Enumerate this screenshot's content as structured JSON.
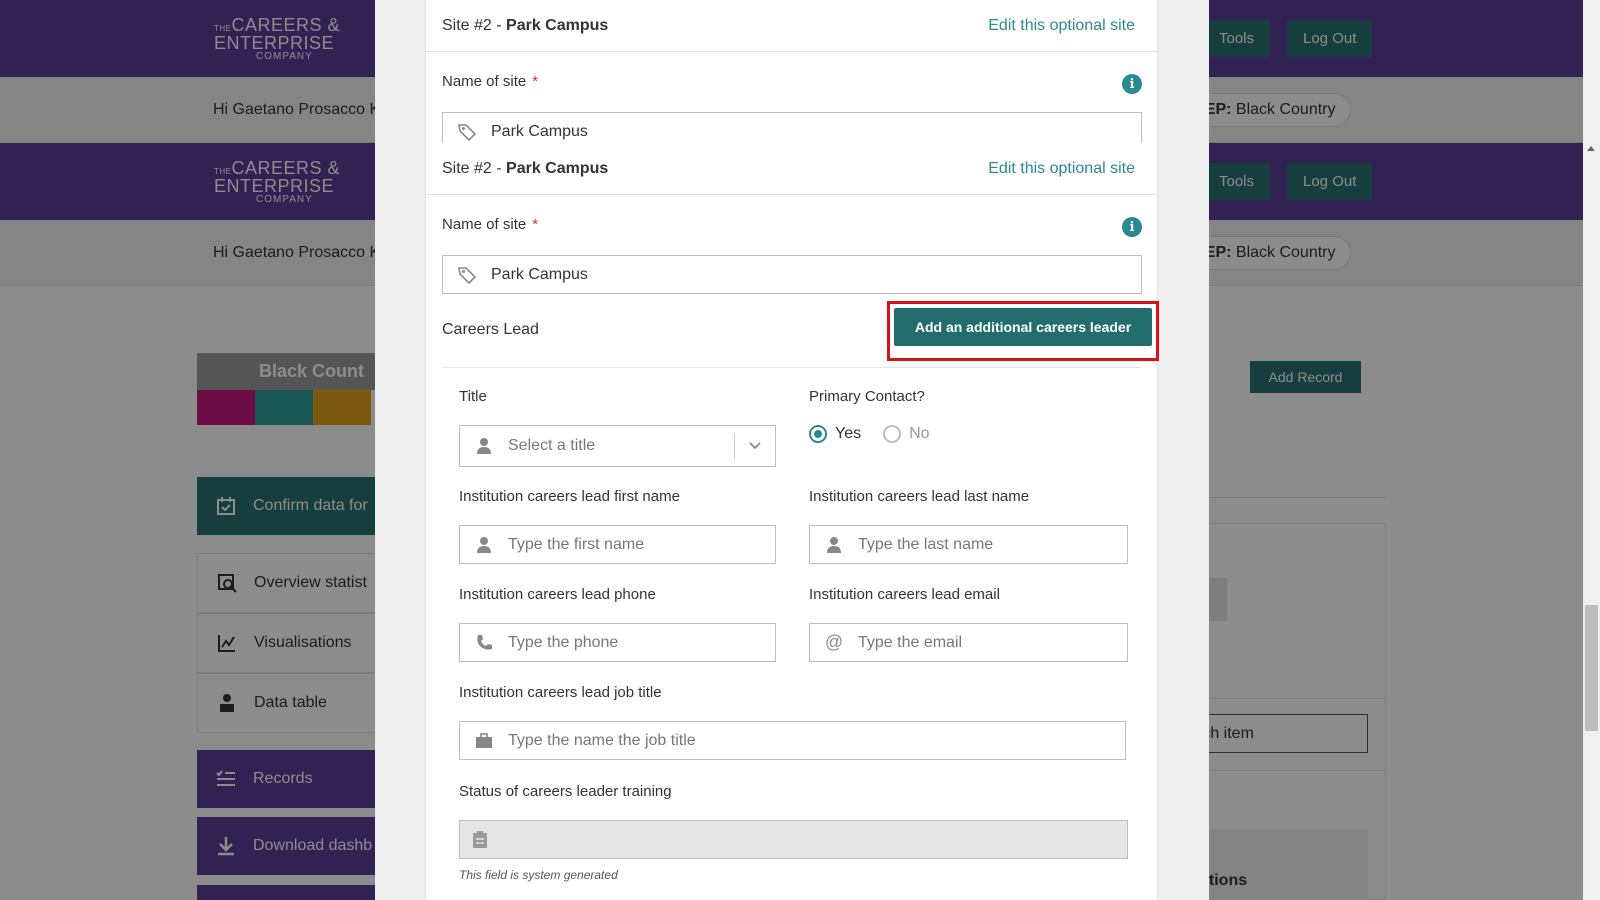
{
  "background": {
    "logo": {
      "line1": "CAREERS &",
      "line2": "ENTERPRISE",
      "line3": "COMPANY",
      "prefix": "THE"
    },
    "header_buttons": {
      "tools": "Tools",
      "logout": "Log Out"
    },
    "greeting": "Hi Gaetano Prosacco K",
    "lep": {
      "label": "LEP:",
      "value": "Black Country"
    },
    "sidebar": {
      "region_title": "Black Count",
      "swatch_colors": [
        "#c4187c",
        "#2f9e9a",
        "#e0a21b"
      ],
      "confirm": "Confirm data for",
      "items": [
        "Overview statist",
        "Visualisations",
        "Data table"
      ],
      "records": "Records",
      "download": "Download dashb"
    },
    "add_record": "Add Record",
    "search_placeholder": "rch item",
    "sections_label": "ctions"
  },
  "modal": {
    "site_prefix": "Site #2 - ",
    "site_name": "Park Campus",
    "edit_link": "Edit this optional site",
    "name_label": "Name of site",
    "required_mark": "*",
    "info_glyph": "i",
    "name_value": "Park Campus",
    "careers_lead_label": "Careers Lead",
    "add_leader_button": "Add an additional careers leader",
    "title_label": "Title",
    "title_placeholder": "Select a title",
    "primary_label": "Primary Contact?",
    "primary_yes": "Yes",
    "primary_no": "No",
    "first_label": "Institution careers lead first name",
    "first_placeholder": "Type the first name",
    "last_label": "Institution careers lead last name",
    "last_placeholder": "Type the last name",
    "phone_label": "Institution careers lead phone",
    "phone_placeholder": "Type the phone",
    "email_label": "Institution careers lead email",
    "email_placeholder": "Type the email",
    "job_label": "Institution careers lead job title",
    "job_placeholder": "Type the name the job title",
    "training_label": "Status of careers leader training",
    "system_note": "This field is system generated"
  },
  "colors": {
    "accent": "#2b8a8f",
    "header": "#5b3f99",
    "button": "#236d6d",
    "highlight": "#d8101a"
  }
}
